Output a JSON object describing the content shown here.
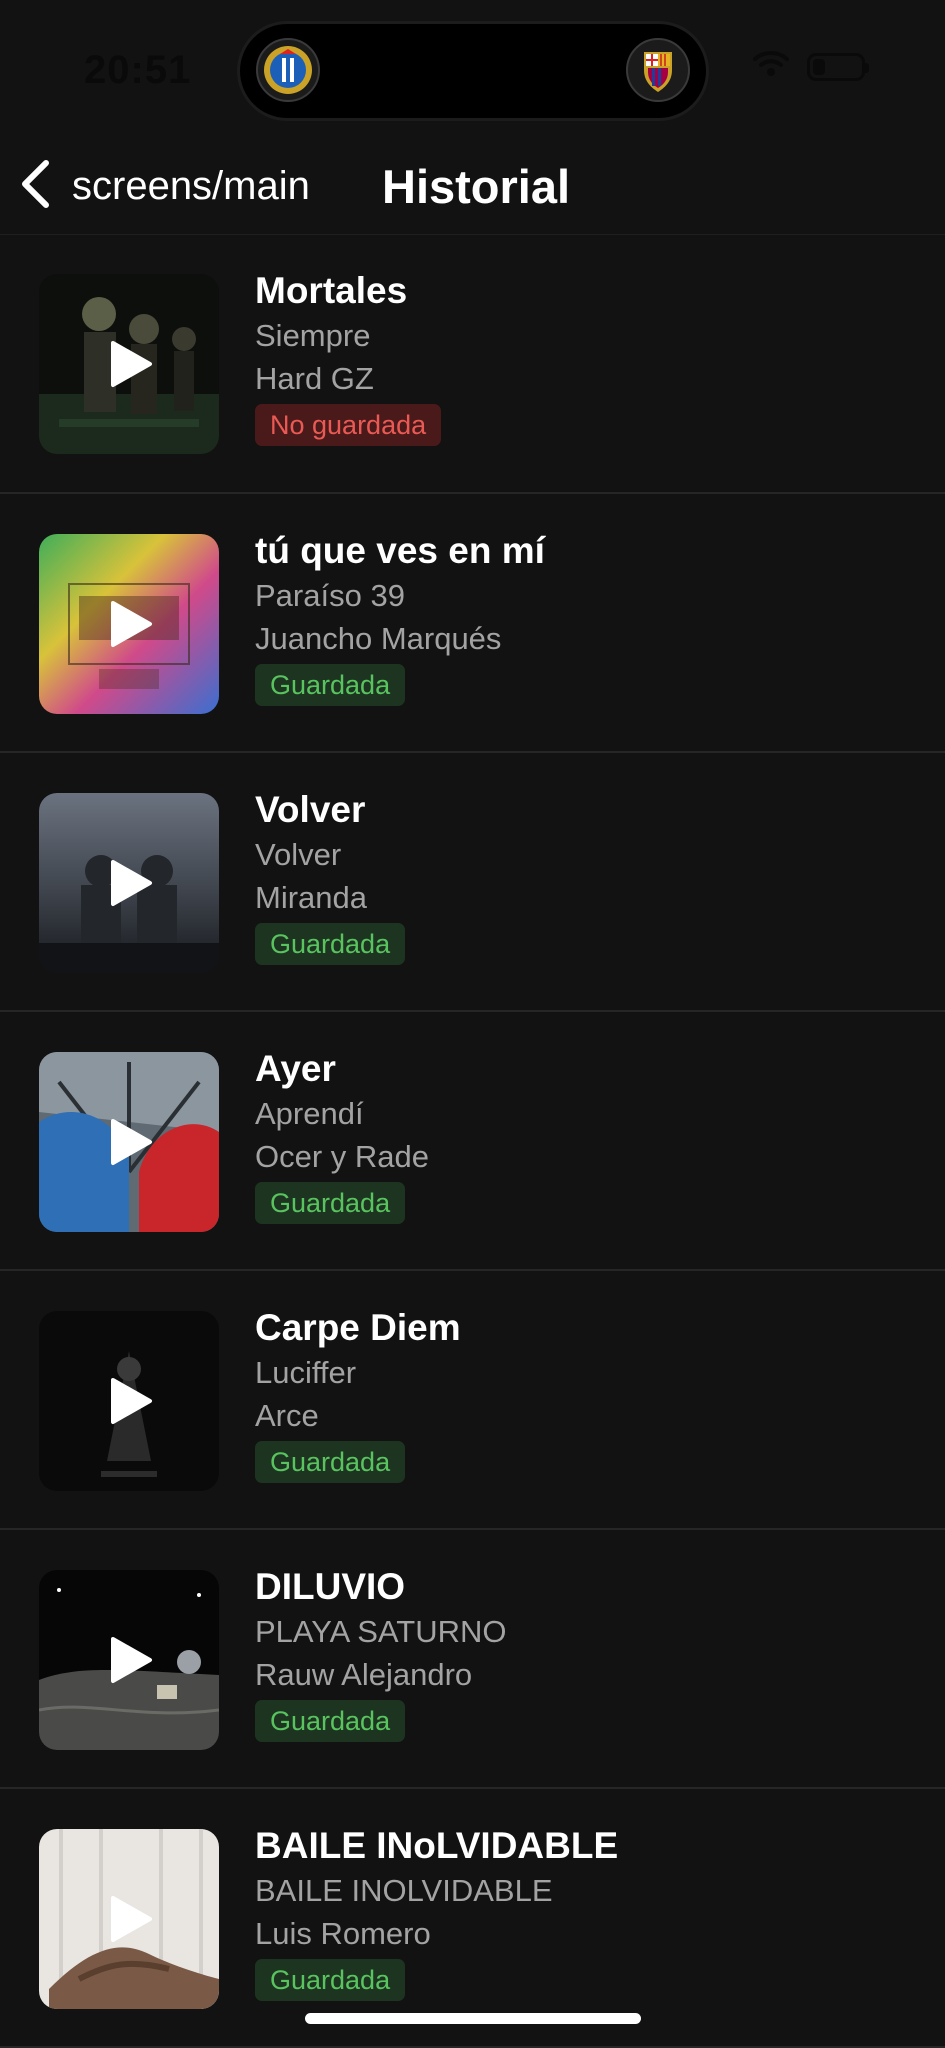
{
  "status_bar": {
    "time": "20:51",
    "left_crest": "rcd-espanyol-crest",
    "right_crest": "fc-barcelona-crest",
    "icons": [
      "wifi-icon",
      "battery-icon"
    ],
    "battery_level": 0.25
  },
  "nav": {
    "back_label": "screens/main",
    "title": "Historial"
  },
  "colors": {
    "background": "#121212",
    "saved_text": "#59c35f",
    "saved_bg": "#1d3520",
    "unsaved_text": "#ea5a55",
    "unsaved_bg": "#4a1a1a"
  },
  "songs": [
    {
      "title": "Mortales",
      "album": "Siempre",
      "artist": "Hard GZ",
      "status": "No guardada",
      "saved": false
    },
    {
      "title": "tú que ves en mí",
      "album": "Paraíso 39",
      "artist": "Juancho Marqués",
      "status": "Guardada",
      "saved": true
    },
    {
      "title": "Volver",
      "album": "Volver",
      "artist": "Miranda",
      "status": "Guardada",
      "saved": true
    },
    {
      "title": "Ayer",
      "album": "Aprendí",
      "artist": "Ocer y Rade",
      "status": "Guardada",
      "saved": true
    },
    {
      "title": "Carpe Diem",
      "album": "Luciffer",
      "artist": "Arce",
      "status": "Guardada",
      "saved": true
    },
    {
      "title": "DILUVIO",
      "album": "PLAYA SATURNO",
      "artist": "Rauw Alejandro",
      "status": "Guardada",
      "saved": true
    },
    {
      "title": "BAILE INoLVIDABLE",
      "album": "BAILE INOLVIDABLE",
      "artist": "Luis Romero",
      "status": "Guardada",
      "saved": true
    }
  ]
}
